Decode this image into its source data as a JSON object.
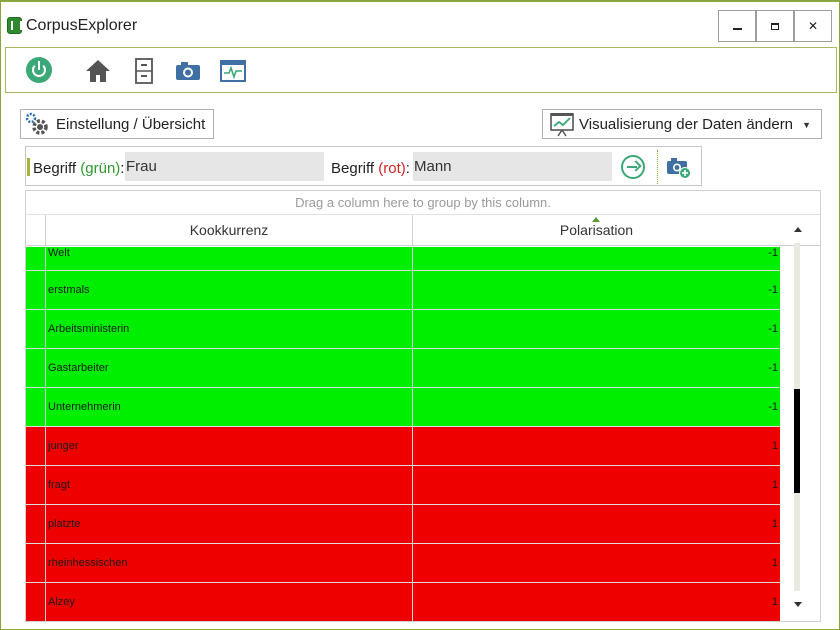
{
  "window": {
    "title": "CorpusExplorer",
    "minimize_label": "",
    "maximize_label": "",
    "close_label": "✕"
  },
  "toolbar": {
    "icons": [
      "power-icon",
      "home-icon",
      "cabinet-icon",
      "camera-icon",
      "monitor-icon"
    ]
  },
  "panel": {
    "settings_label": "Einstellung / Übersicht",
    "visualize_label": "Visualisierung der Daten ändern"
  },
  "filter": {
    "term_label": "Begriff",
    "green_tag": "(grün)",
    "red_tag": "(rot)",
    "colon": ":",
    "term_green_value": "Frau",
    "term_red_value": "Mann"
  },
  "grid": {
    "group_hint": "Drag a column here to group by this column.",
    "columns": [
      "Kookkurrenz",
      "Polarisation"
    ],
    "sorted_column": "Polarisation",
    "rows": [
      {
        "term": "Welt",
        "polarisation": "-1",
        "color": "#00ee00"
      },
      {
        "term": "erstmals",
        "polarisation": "-1",
        "color": "#00ee00"
      },
      {
        "term": "Arbeitsministerin",
        "polarisation": "-1",
        "color": "#00ee00"
      },
      {
        "term": "Gastarbeiter",
        "polarisation": "-1",
        "color": "#00ee00"
      },
      {
        "term": "Unternehmerin",
        "polarisation": "-1",
        "color": "#00ee00"
      },
      {
        "term": "junger",
        "polarisation": "1",
        "color": "#ee0000"
      },
      {
        "term": "fragt",
        "polarisation": "1",
        "color": "#ee0000"
      },
      {
        "term": "platzte",
        "polarisation": "1",
        "color": "#ee0000"
      },
      {
        "term": "rheinhessischen",
        "polarisation": "1",
        "color": "#ee0000"
      },
      {
        "term": "Alzey",
        "polarisation": "1",
        "color": "#ee0000"
      }
    ],
    "scroll_position": 0.6
  },
  "colors": {
    "accent": "#8aa640",
    "green_row": "#00ee00",
    "red_row": "#ee0000",
    "icon_blue": "#3f6fa3",
    "icon_teal": "#3aa877"
  }
}
